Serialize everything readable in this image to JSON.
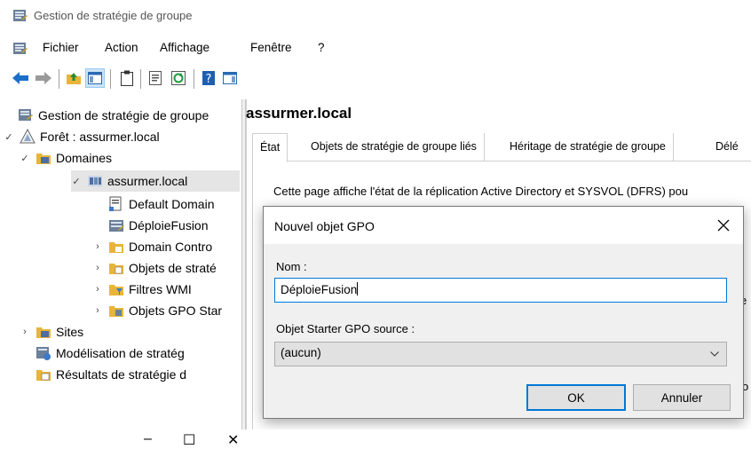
{
  "window": {
    "title": "Gestion de stratégie de groupe"
  },
  "menu": [
    "Fichier",
    "Action",
    "Affichage",
    "Fenêtre",
    "?"
  ],
  "tree": {
    "root": "Gestion de stratégie de groupe",
    "forest": "Forêt : assurmer.local",
    "domains": "Domaines",
    "domain": "assurmer.local",
    "default_domain": "Default Domain",
    "deploiefusion": "DéploieFusion",
    "domain_controllers": "Domain Contro",
    "gpo_objects": "Objets de straté",
    "wmi_filters": "Filtres WMI",
    "starter_gpo": "Objets GPO Star",
    "sites": "Sites",
    "modeling": "Modélisation de stratég",
    "results": "Résultats de stratégie d"
  },
  "right": {
    "header": "assurmer.local",
    "tabs": [
      "État",
      "Objets de stratégie de groupe liés",
      "Héritage de stratégie de groupe",
      "Délé"
    ],
    "description": "Cette page affiche l'état de la réplication Active Directory et SYSVOL (DFRS) pou",
    "frag1": "e l",
    "frag2": "o"
  },
  "dialog": {
    "title": "Nouvel objet GPO",
    "name_label": "Nom :",
    "name_value": "DéploieFusion",
    "source_label": "Objet Starter GPO source :",
    "source_value": "(aucun)",
    "ok_label": "OK",
    "cancel_label": "Annuler"
  },
  "bottom": {
    "minimize": "–",
    "maximize": "☐",
    "close": "✕"
  }
}
